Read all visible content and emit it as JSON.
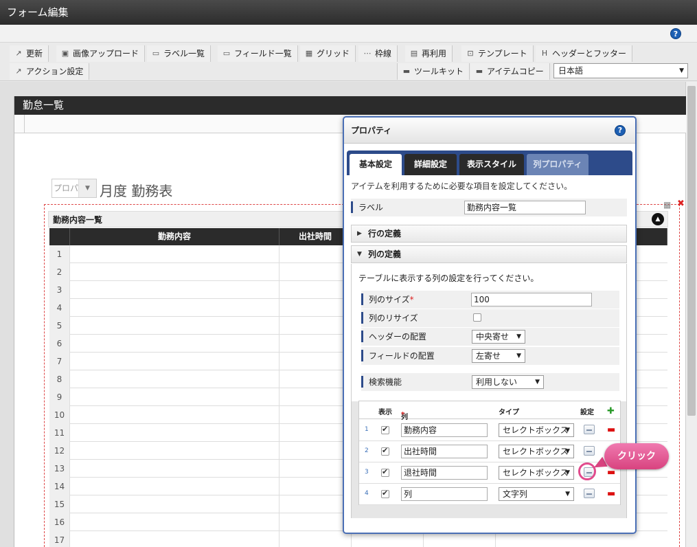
{
  "window": {
    "title": "フォーム編集"
  },
  "colors": {
    "accent": "#2d4b8a",
    "callout": "#e14a8c",
    "header_dark": "#2b2b2b"
  },
  "toolbar": {
    "row1": [
      {
        "label": "更新",
        "icon": "update-icon"
      },
      {
        "label": "画像アップロード",
        "icon": "image-upload-icon"
      },
      {
        "label": "ラベル一覧",
        "icon": "label-list-icon"
      },
      {
        "label": "フィールド一覧",
        "icon": "field-list-icon"
      },
      {
        "label": "グリッド",
        "icon": "grid-icon"
      },
      {
        "label": "枠線",
        "icon": "border-icon"
      },
      {
        "label": "再利用",
        "icon": "reuse-icon"
      },
      {
        "label": "テンプレート",
        "icon": "template-icon"
      },
      {
        "label": "ヘッダーとフッター",
        "icon": "header-footer-icon"
      }
    ],
    "row2_left": {
      "label": "アクション設定",
      "icon": "action-icon"
    },
    "row2_right": [
      {
        "label": "ツールキット",
        "icon": "toolkit-icon"
      },
      {
        "label": "アイテムコピー",
        "icon": "item-copy-icon"
      }
    ],
    "language": "日本語"
  },
  "form": {
    "title": "勤怠一覧",
    "month_select_placeholder": "プロパ",
    "month_label": "月度 勤務表",
    "table": {
      "title": "勤務内容一覧",
      "headers": [
        "勤務内容",
        "出社時間"
      ],
      "row_numbers": [
        "1",
        "2",
        "3",
        "4",
        "5",
        "6",
        "7",
        "8",
        "9",
        "10",
        "11",
        "12",
        "13",
        "14",
        "15",
        "16",
        "17"
      ]
    }
  },
  "properties": {
    "title": "プロパティ",
    "tabs": [
      {
        "label": "基本設定",
        "state": "active"
      },
      {
        "label": "詳細設定",
        "state": "normal"
      },
      {
        "label": "表示スタイル",
        "state": "normal"
      },
      {
        "label": "列プロパティ",
        "state": "disabled"
      }
    ],
    "hint": "アイテムを利用するために必要な項目を設定してください。",
    "label_field": {
      "label": "ラベル",
      "value": "勤務内容一覧"
    },
    "sections": {
      "rows": "行の定義",
      "columns": "列の定義"
    },
    "columns_hint": "テーブルに表示する列の設定を行ってください。",
    "col_size": {
      "label": "列のサイズ",
      "value": "100"
    },
    "col_resize": {
      "label": "列のリサイズ",
      "checked": false
    },
    "header_align": {
      "label": "ヘッダーの配置",
      "value": "中央寄せ"
    },
    "field_align": {
      "label": "フィールドの配置",
      "value": "左寄せ"
    },
    "search": {
      "label": "検索機能",
      "value": "利用しない"
    },
    "col_table": {
      "headers": {
        "show": "表示",
        "name": "列名",
        "type": "タイプ",
        "settings": "設定"
      },
      "rows": [
        {
          "index": "1",
          "checked": true,
          "name": "勤務内容",
          "type": "セレクトボックス"
        },
        {
          "index": "2",
          "checked": true,
          "name": "出社時間",
          "type": "セレクトボックス"
        },
        {
          "index": "3",
          "checked": true,
          "name": "退社時間",
          "type": "セレクトボックス"
        },
        {
          "index": "4",
          "checked": true,
          "name": "列",
          "type": "文字列"
        }
      ]
    }
  },
  "callout": {
    "label": "クリック"
  }
}
